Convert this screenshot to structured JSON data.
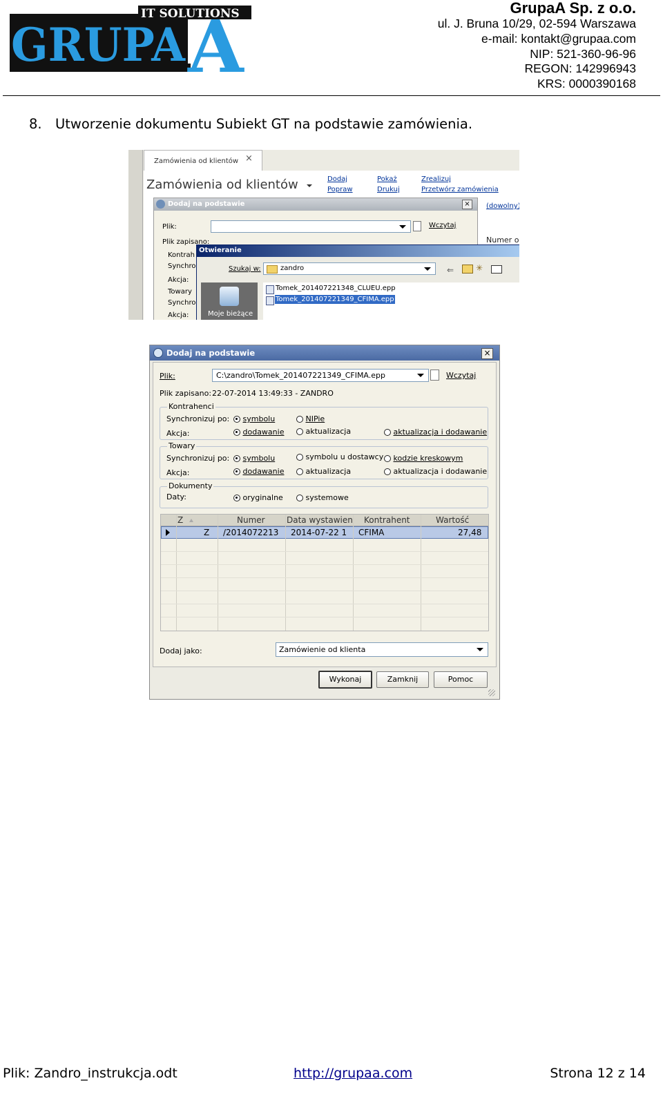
{
  "header": {
    "logo_text": "GRUPA",
    "logo_letter": "A",
    "logo_tagline": "IT SOLUTIONS",
    "company_name": "GrupaA Sp. z o.o.",
    "address": "ul. J. Bruna 10/29, 02-594 Warszawa",
    "email": "e-mail: kontakt@grupaa.com",
    "nip": "NIP: 521-360-96-96",
    "regon": "REGON: 142996943",
    "krs": "KRS: 0000390168"
  },
  "heading": {
    "number": "8.",
    "text": "Utworzenie dokumentu Subiekt GT na podstawie zamówienia."
  },
  "shot1": {
    "tab_label": "Zamówienia od klientów",
    "tab_close": "×",
    "title": "Zamówienia od klientów",
    "menu": {
      "dodaj": "Dodaj",
      "popraw": "Popraw",
      "pokaz": "Pokaż",
      "drukuj": "Drukuj",
      "zrealizuj": "Zrealizuj",
      "przetworz": "Przetwórz zamówienia",
      "dowolny": "(dowolny)",
      "numer": "Numer o"
    },
    "dialog_title": "Dodaj na podstawie",
    "plik_label": "Plik:",
    "wczytaj": "Wczytaj",
    "plik_zapisano": "Plik zapisano:",
    "side_labels": [
      "Kontrah",
      "Synchro",
      "Akcja:",
      "Towary",
      "Synchro",
      "Akcja:"
    ],
    "open_dialog": {
      "title": "Otwieranie",
      "szukaj_label": "Szukaj w:",
      "folder": "zandro",
      "places_label": "Moje bieżące",
      "files": [
        "Tomek_201407221348_CLUEU.epp",
        "Tomek_201407221349_CFIMA.epp"
      ],
      "selected_index": 1
    }
  },
  "dialog": {
    "title": "Dodaj na podstawie",
    "close": "×",
    "plik_label": "Plik:",
    "plik_value": "C:\\zandro\\Tomek_201407221349_CFIMA.epp",
    "wczytaj": "Wczytaj",
    "saved_label": "Plik zapisano:",
    "saved_value": "22-07-2014 13:49:33 - ZANDRO",
    "kontrahenci": {
      "legend": "Kontrahenci",
      "sync_label": "Synchronizuj po:",
      "sync_options": [
        {
          "label": "symbolu",
          "checked": true
        },
        {
          "label": "NIPie",
          "checked": false
        }
      ],
      "action_label": "Akcja:",
      "action_options": [
        {
          "label": "dodawanie",
          "checked": true
        },
        {
          "label": "aktualizacja",
          "checked": false
        },
        {
          "label": "aktualizacja i dodawanie",
          "checked": false
        }
      ]
    },
    "towary": {
      "legend": "Towary",
      "sync_label": "Synchronizuj po:",
      "sync_options": [
        {
          "label": "symbolu",
          "checked": true
        },
        {
          "label": "symbolu u dostawcy",
          "checked": false
        },
        {
          "label": "kodzie kreskowym",
          "checked": false
        }
      ],
      "action_label": "Akcja:",
      "action_options": [
        {
          "label": "dodawanie",
          "checked": true
        },
        {
          "label": "aktualizacja",
          "checked": false
        },
        {
          "label": "aktualizacja i dodawanie",
          "checked": false
        }
      ]
    },
    "dokumenty": {
      "legend": "Dokumenty",
      "daty_label": "Daty:",
      "options": [
        {
          "label": "oryginalne",
          "checked": true
        },
        {
          "label": "systemowe",
          "checked": false
        }
      ]
    },
    "table": {
      "columns": [
        "Z",
        "Numer",
        "Data wystawien",
        "Kontrahent",
        "Wartość"
      ],
      "rows": [
        [
          "Z",
          "/2014072213",
          "2014-07-22 1",
          "CFIMA",
          "27,48"
        ]
      ]
    },
    "dodaj_jako_label": "Dodaj jako:",
    "dodaj_jako_value": "Zamówienie od klienta",
    "buttons": {
      "wykonaj": "Wykonaj",
      "zamknij": "Zamknij",
      "pomoc": "Pomoc"
    }
  },
  "footer": {
    "file": "Plik: Zandro_instrukcja.odt",
    "link": "http://grupaa.com",
    "page": "Strona 12 z 14"
  }
}
